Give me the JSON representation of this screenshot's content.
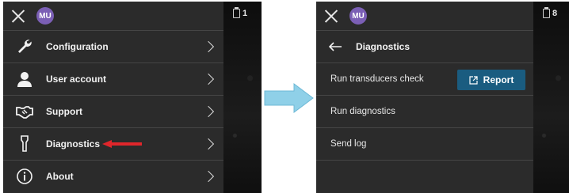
{
  "left_panel": {
    "user_initials": "MU",
    "probe_count": "1",
    "menu_items": [
      {
        "label": "Configuration",
        "icon": "wrench-icon"
      },
      {
        "label": "User account",
        "icon": "user-icon"
      },
      {
        "label": "Support",
        "icon": "handshake-icon"
      },
      {
        "label": "Diagnostics",
        "icon": "probe-icon"
      },
      {
        "label": "About",
        "icon": "info-icon"
      }
    ]
  },
  "right_panel": {
    "user_initials": "MU",
    "probe_count": "8",
    "title": "Diagnostics",
    "rows": [
      {
        "label": "Run transducers check"
      },
      {
        "label": "Run diagnostics"
      },
      {
        "label": "Send log"
      }
    ],
    "report_label": "Report"
  },
  "colors": {
    "panel_bg": "#2b2b2b",
    "avatar": "#7b5fb5",
    "report_button": "#1a5c80",
    "highlight_arrow": "#e0262b",
    "transition_arrow": "#8fd0e8"
  }
}
